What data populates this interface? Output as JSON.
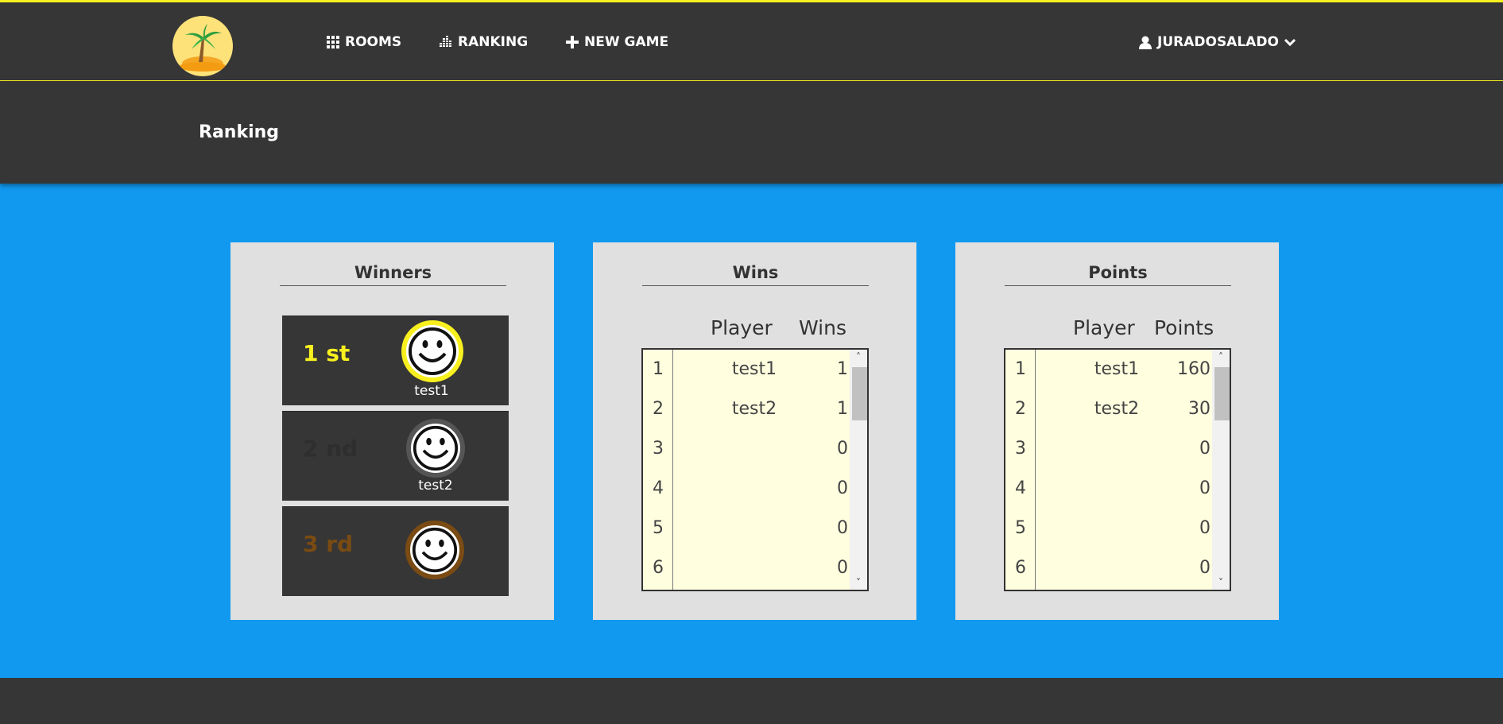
{
  "nav": {
    "items": [
      {
        "label": "ROOMS",
        "icon": "grid-icon"
      },
      {
        "label": "RANKING",
        "icon": "bar-chart-icon"
      },
      {
        "label": "NEW GAME",
        "icon": "plus-icon"
      }
    ],
    "user": {
      "label": "JURADOSALADO",
      "icon": "user-icon"
    }
  },
  "header": {
    "title": "Ranking"
  },
  "winners": {
    "title": "Winners",
    "places": [
      {
        "label": "1 st",
        "player": "test1",
        "color": "#f7f01e"
      },
      {
        "label": "2 nd",
        "player": "test2",
        "color": "#2e2e2e"
      },
      {
        "label": "3 rd",
        "player": "",
        "color": "#7a4b12"
      }
    ]
  },
  "wins": {
    "title": "Wins",
    "columns": [
      "Player",
      "Wins"
    ],
    "rows": [
      {
        "rank": "1",
        "player": "test1",
        "value": "1"
      },
      {
        "rank": "2",
        "player": "test2",
        "value": "1"
      },
      {
        "rank": "3",
        "player": "",
        "value": "0"
      },
      {
        "rank": "4",
        "player": "",
        "value": "0"
      },
      {
        "rank": "5",
        "player": "",
        "value": "0"
      },
      {
        "rank": "6",
        "player": "",
        "value": "0"
      }
    ]
  },
  "points": {
    "title": "Points",
    "columns": [
      "Player",
      "Points"
    ],
    "rows": [
      {
        "rank": "1",
        "player": "test1",
        "value": "160"
      },
      {
        "rank": "2",
        "player": "test2",
        "value": "30"
      },
      {
        "rank": "3",
        "player": "",
        "value": "0"
      },
      {
        "rank": "4",
        "player": "",
        "value": "0"
      },
      {
        "rank": "5",
        "player": "",
        "value": "0"
      },
      {
        "rank": "6",
        "player": "",
        "value": "0"
      }
    ]
  },
  "colors": {
    "accent": "#f7f01e",
    "background": "#1199f0",
    "navbar": "#363636",
    "panel": "#e0e0e0",
    "table": "#ffffe0"
  }
}
